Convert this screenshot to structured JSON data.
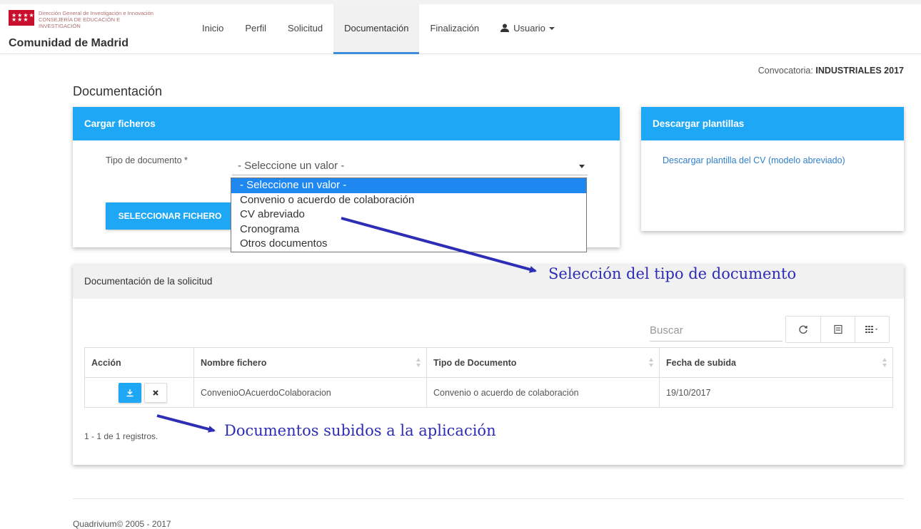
{
  "brand": {
    "line1": "Dirección General de Investigación e Innovación",
    "line2": "CONSEJERÍA DE EDUCACIÓN E",
    "line3": "INVESTIGACIÓN",
    "name": "Comunidad de Madrid"
  },
  "nav": {
    "items": [
      {
        "label": "Inicio"
      },
      {
        "label": "Perfil"
      },
      {
        "label": "Solicitud"
      },
      {
        "label": "Documentación"
      },
      {
        "label": "Finalización"
      },
      {
        "label": "Usuario"
      }
    ],
    "active_index": 3
  },
  "convocatoria": {
    "label": "Convocatoria:",
    "value": "INDUSTRIALES 2017"
  },
  "page_title": "Documentación",
  "upload_card": {
    "title": "Cargar ficheros",
    "doc_type_label": "Tipo de documento *",
    "select_value": "- Seleccione un valor -",
    "select_file_button": "SELECCIONAR FICHERO",
    "options": [
      "- Seleccione un valor -",
      "Convenio o acuerdo de colaboración",
      "CV abreviado",
      "Cronograma",
      "Otros documentos"
    ]
  },
  "templates_card": {
    "title": "Descargar plantillas",
    "link": "Descargar plantilla del CV (modelo abreviado)"
  },
  "docs_card": {
    "title": "Documentación de la solicitud",
    "search_placeholder": "Buscar",
    "columns": [
      "Acción",
      "Nombre fichero",
      "Tipo de Documento",
      "Fecha de subida"
    ],
    "rows": [
      {
        "name": "ConvenioOAcuerdoColaboracion",
        "type": "Convenio o acuerdo de colaboración",
        "date": "19/10/2017"
      }
    ],
    "records": "1 - 1 de 1 registros."
  },
  "annotations": {
    "select_type": "Selección del tipo de documento",
    "uploaded": "Documentos subidos a la aplicación"
  },
  "footer": "Quadrivium© 2005 - 2017",
  "colors": {
    "accent": "#1ea7f4",
    "annotation": "#2d2db5",
    "nav_active_border": "#3f8ed9"
  }
}
